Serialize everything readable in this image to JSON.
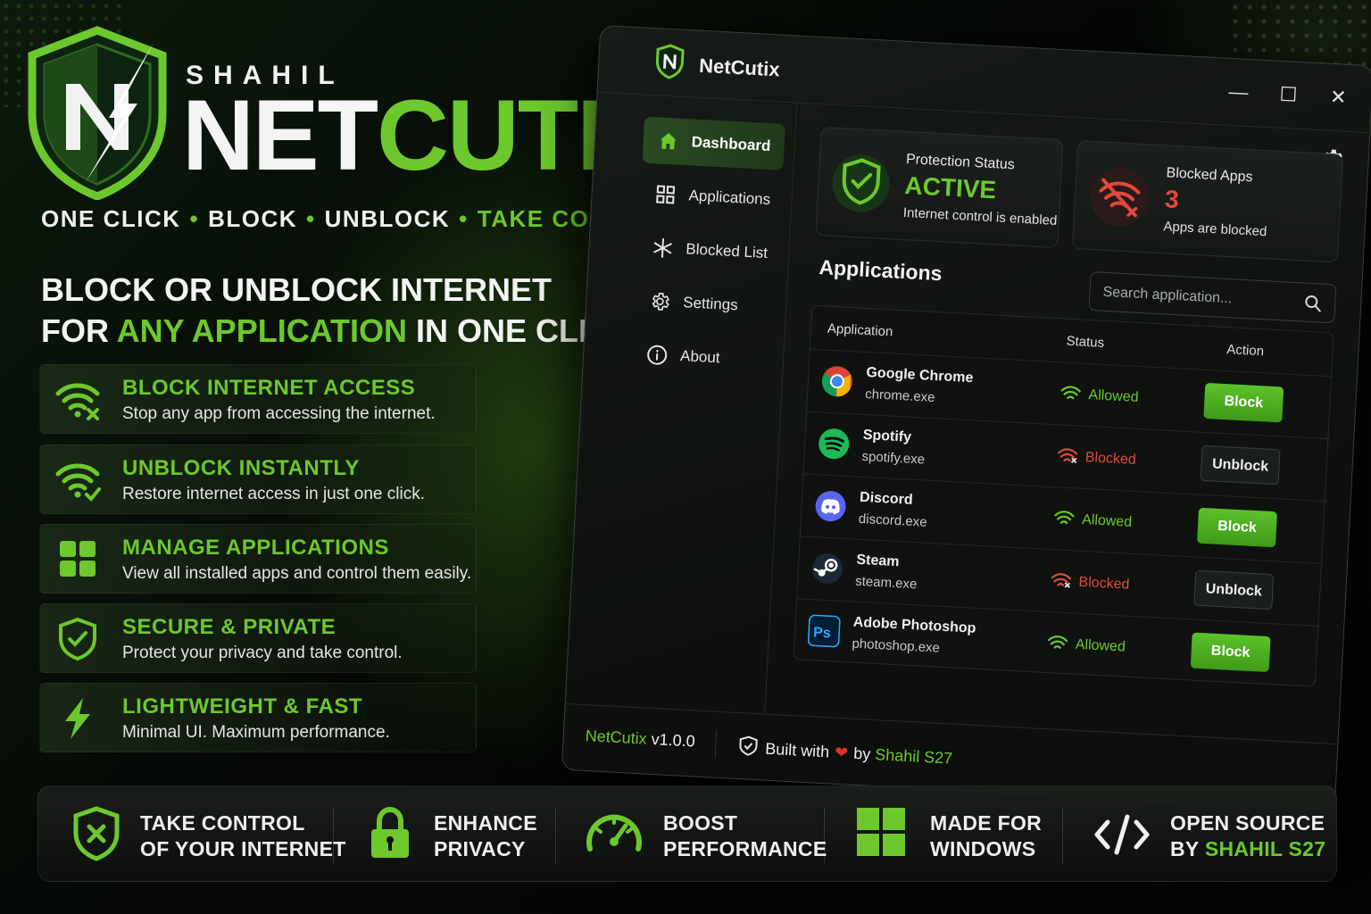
{
  "brand": {
    "author": "SHAHIL",
    "title_part1": "NET",
    "title_part2": "CUTIX",
    "tagline": [
      "ONE CLICK",
      "BLOCK",
      "UNBLOCK",
      "TAKE CONTROL"
    ]
  },
  "headline": {
    "line1": "BLOCK OR UNBLOCK INTERNET",
    "line2_pre": "FOR ",
    "line2_hl": "ANY APPLICATION",
    "line2_post": " IN ONE CLICK"
  },
  "features": [
    {
      "title": "BLOCK INTERNET ACCESS",
      "desc": "Stop any app from accessing the internet.",
      "icon": "wifi-block-icon"
    },
    {
      "title": "UNBLOCK INSTANTLY",
      "desc": "Restore internet access in just one click.",
      "icon": "wifi-check-icon"
    },
    {
      "title": "MANAGE APPLICATIONS",
      "desc": "View all installed apps and control them easily.",
      "icon": "grid-icon"
    },
    {
      "title": "SECURE & PRIVATE",
      "desc": "Protect your privacy and take control.",
      "icon": "shield-check-icon"
    },
    {
      "title": "LIGHTWEIGHT & FAST",
      "desc": "Minimal UI. Maximum performance.",
      "icon": "lightning-icon"
    }
  ],
  "bottom_bar": [
    {
      "line1": "TAKE CONTROL",
      "line2": "OF YOUR INTERNET",
      "icon": "shield-x-icon"
    },
    {
      "line1": "ENHANCE",
      "line2": "PRIVACY",
      "icon": "lock-icon"
    },
    {
      "line1": "BOOST",
      "line2": "PERFORMANCE",
      "icon": "speedometer-icon"
    },
    {
      "line1": "MADE FOR",
      "line2": "WINDOWS",
      "icon": "windows-icon"
    },
    {
      "line1": "OPEN SOURCE",
      "line2_pre": "BY ",
      "line2_hl": "SHAHIL S27",
      "icon": "code-icon"
    }
  ],
  "app": {
    "title": "NetCutix",
    "window_controls": {
      "minimize": "—",
      "maximize": "☐",
      "close": "✕"
    },
    "nav": [
      {
        "label": "Dashboard",
        "icon": "home-icon",
        "active": true
      },
      {
        "label": "Applications",
        "icon": "apps-grid-icon",
        "active": false
      },
      {
        "label": "Blocked List",
        "icon": "blocked-list-icon",
        "active": false
      },
      {
        "label": "Settings",
        "icon": "gear-icon",
        "active": false
      },
      {
        "label": "About",
        "icon": "info-icon",
        "active": false
      }
    ],
    "protection_card": {
      "label": "Protection Status",
      "value": "ACTIVE",
      "sub": "Internet control is enabled"
    },
    "blocked_card": {
      "label": "Blocked Apps",
      "value": "3",
      "sub": "Apps are blocked"
    },
    "section_title": "Applications",
    "search_placeholder": "Search application...",
    "table_headers": {
      "application": "Application",
      "status": "Status",
      "action": "Action"
    },
    "rows": [
      {
        "name": "Google Chrome",
        "exe": "chrome.exe",
        "status": "Allowed",
        "action": "Block",
        "icon": "chrome-icon"
      },
      {
        "name": "Spotify",
        "exe": "spotify.exe",
        "status": "Blocked",
        "action": "Unblock",
        "icon": "spotify-icon"
      },
      {
        "name": "Discord",
        "exe": "discord.exe",
        "status": "Allowed",
        "action": "Block",
        "icon": "discord-icon"
      },
      {
        "name": "Steam",
        "exe": "steam.exe",
        "status": "Blocked",
        "action": "Unblock",
        "icon": "steam-icon"
      },
      {
        "name": "Adobe Photoshop",
        "exe": "photoshop.exe",
        "status": "Allowed",
        "action": "Block",
        "icon": "photoshop-icon"
      }
    ],
    "footer": {
      "app_name": "NetCutix",
      "version": " v1.0.0",
      "built_with": "Built with",
      "heart": "❤",
      "by": "by",
      "author": "Shahil S27"
    }
  },
  "colors": {
    "accent_green": "#6cc82c",
    "blocked_red": "#e04a3a",
    "background": "#050805"
  }
}
